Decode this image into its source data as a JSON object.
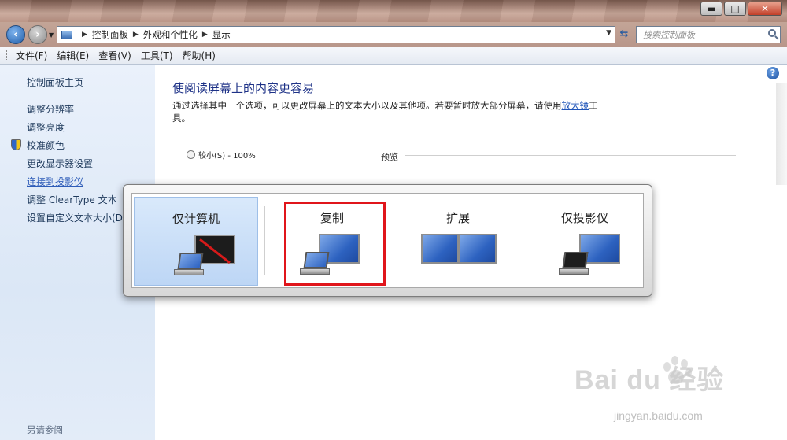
{
  "window": {
    "controls": {
      "minimize": "▬",
      "maximize": "□",
      "close": "✕"
    }
  },
  "address": {
    "crumbs": [
      "控制面板",
      "外观和个性化",
      "显示"
    ],
    "search_placeholder": "搜索控制面板"
  },
  "menu": [
    "文件(F)",
    "编辑(E)",
    "查看(V)",
    "工具(T)",
    "帮助(H)"
  ],
  "sidebar": {
    "home": "控制面板主页",
    "items": [
      {
        "label": "调整分辨率"
      },
      {
        "label": "调整亮度"
      },
      {
        "label": "校准颜色",
        "icon": "shield-icon"
      },
      {
        "label": "更改显示器设置"
      },
      {
        "label": "连接到投影仪",
        "active": true
      },
      {
        "label": "调整 ClearType 文本"
      },
      {
        "label": "设置自定义文本大小(DP"
      }
    ],
    "see_also": "另请参阅"
  },
  "main": {
    "title": "使阅读屏幕上的内容更容易",
    "description_prefix": "通过选择其中一个选项，可以更改屏幕上的文本大小以及其他项。若要暂时放大部分屏幕，请使用",
    "description_link": "放大镜",
    "description_suffix": "工具。",
    "radio_label": "较小(S) - 100%",
    "preview_label": "预览",
    "help_icon": "?"
  },
  "projector": {
    "options": [
      {
        "label": "仅计算机",
        "selected": true
      },
      {
        "label": "复制",
        "highlighted": true
      },
      {
        "label": "扩展"
      },
      {
        "label": "仅投影仪"
      }
    ],
    "highlight_color": "#e0151b"
  },
  "watermark": {
    "logo": "Bai du 经验",
    "url": "jingyan.baidu.com"
  }
}
